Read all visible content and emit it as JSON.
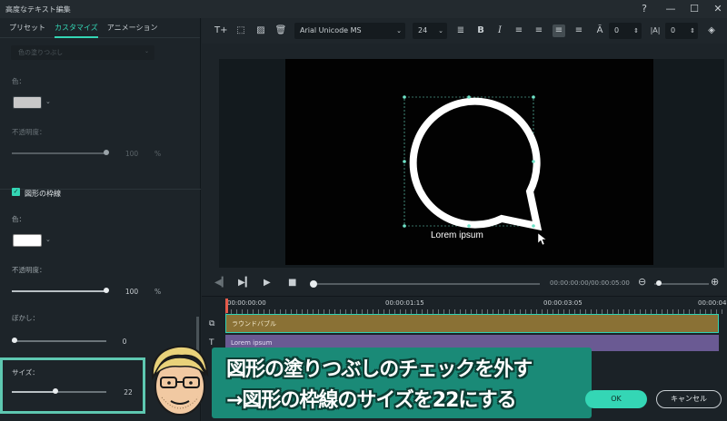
{
  "window": {
    "title": "高度なテキスト編集",
    "help_icon": "help-icon",
    "min_icon": "minimize-icon",
    "max_icon": "maximize-icon",
    "close_icon": "close-icon"
  },
  "tabs": [
    {
      "label": "プリセット"
    },
    {
      "label": "カスタマイズ"
    },
    {
      "label": "アニメーション"
    }
  ],
  "left": {
    "fill_dropdown": "色の塗りつぶし",
    "fill_color_label": "色：",
    "fill_opacity_label": "不透明度：",
    "fill_opacity_value": "100",
    "percent": "%",
    "outline_section": "図形の枠線",
    "outline_color_label": "色：",
    "outline_opacity_label": "不透明度：",
    "outline_opacity_value": "100",
    "blur_label": "ぼかし：",
    "blur_value": "0",
    "size_label": "サイズ：",
    "size_value": "22",
    "fill_color": "#c8c8c8",
    "outline_color": "#ffffff"
  },
  "toolbar": {
    "font": "Arial Unicode MS",
    "font_size": "24",
    "letter_spacing": "0",
    "line_spacing": "0"
  },
  "preview": {
    "text": "Lorem ipsum"
  },
  "playback": {
    "timecode": "00:00:00:00/00:00:05:00"
  },
  "timeline": {
    "times": [
      "00:00:00:00",
      "00:00:01:15",
      "00:00:03:05",
      "00:00:04"
    ],
    "track1_label": "ラウンドバブル",
    "track2_label": "Lorem ipsum"
  },
  "caption": {
    "line1": "図形の塗りつぶしのチェックを外す",
    "line2": "→図形の枠線のサイズを22にする"
  },
  "buttons": {
    "ok": "OK",
    "cancel": "キャンセル"
  },
  "colors": {
    "accent": "#34d6b5",
    "track1": "#8a7135",
    "track2": "#6a5a93",
    "caption_bg": "#1a8a77"
  }
}
